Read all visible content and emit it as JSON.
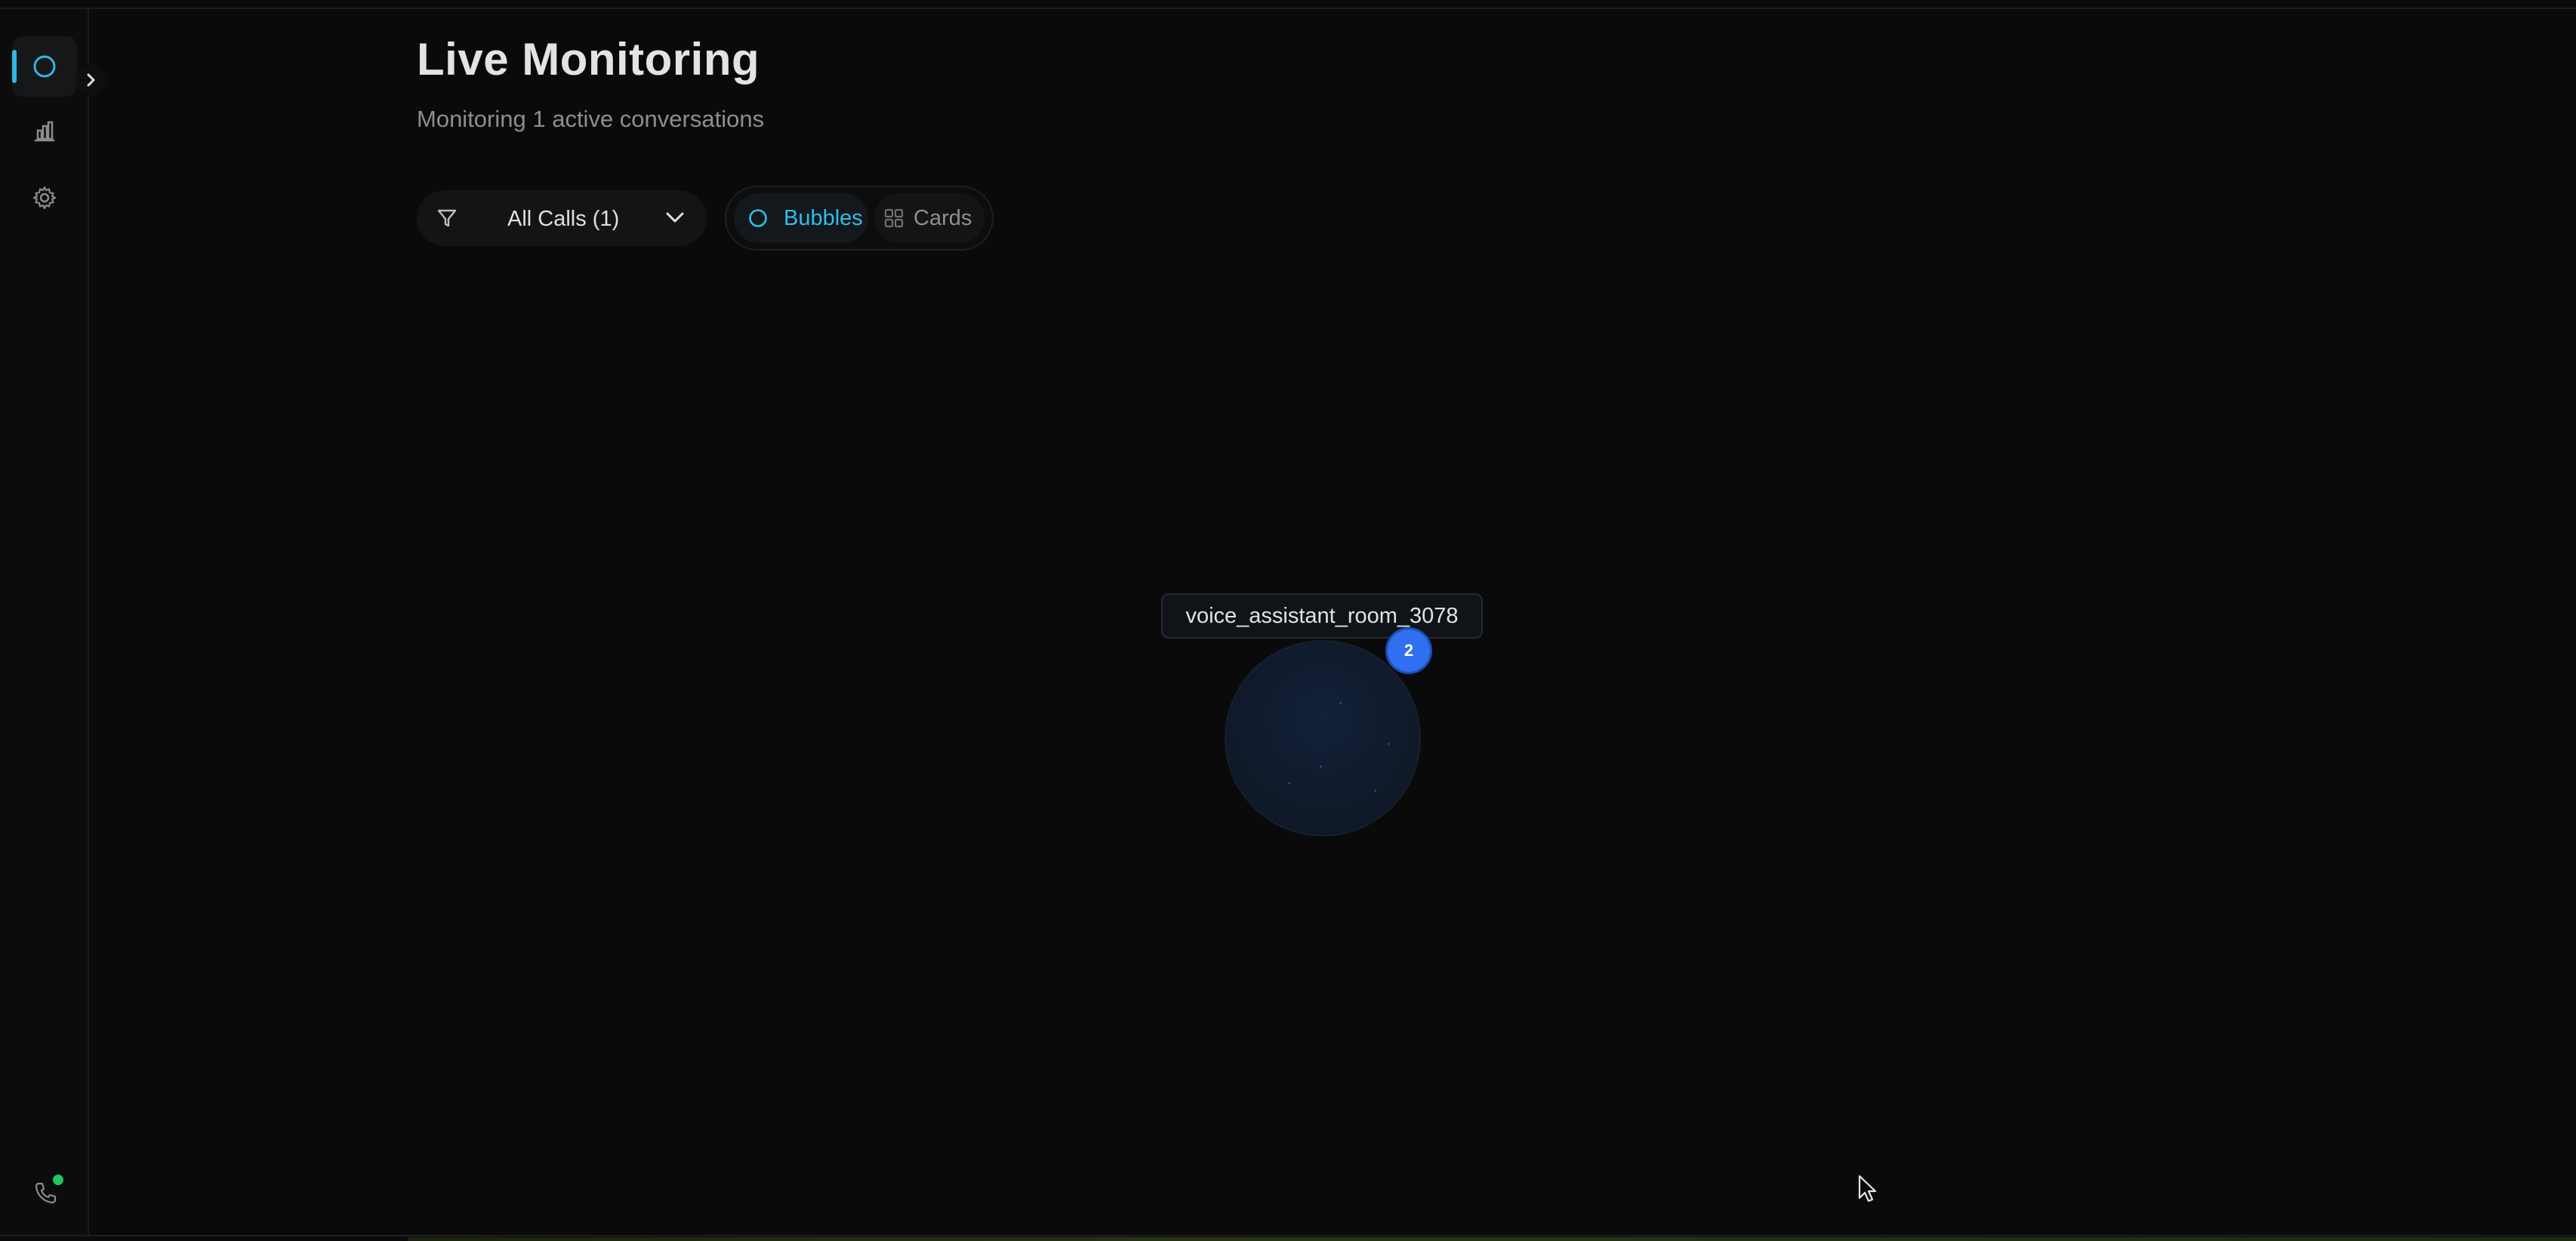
{
  "header": {
    "title": "Live Monitoring",
    "subtitle": "Monitoring 1 active conversations"
  },
  "toolbar": {
    "filter_label": "All Calls (1)",
    "view_modes": {
      "bubbles_label": "Bubbles",
      "cards_label": "Cards",
      "selected": "Bubbles"
    }
  },
  "sidebar": {
    "items": [
      {
        "icon": "circle-icon",
        "active": true
      },
      {
        "icon": "bar-chart-icon",
        "active": false
      },
      {
        "icon": "gear-icon",
        "active": false
      }
    ],
    "status": {
      "icon": "phone-icon",
      "state": "online",
      "color": "#22c55e"
    }
  },
  "conversations": [
    {
      "room": "voice_assistant_room_3078",
      "count": "2"
    }
  ],
  "colors": {
    "accent": "#2fb6e4",
    "badge": "#2f6ff0",
    "background": "#0a0a0a"
  }
}
